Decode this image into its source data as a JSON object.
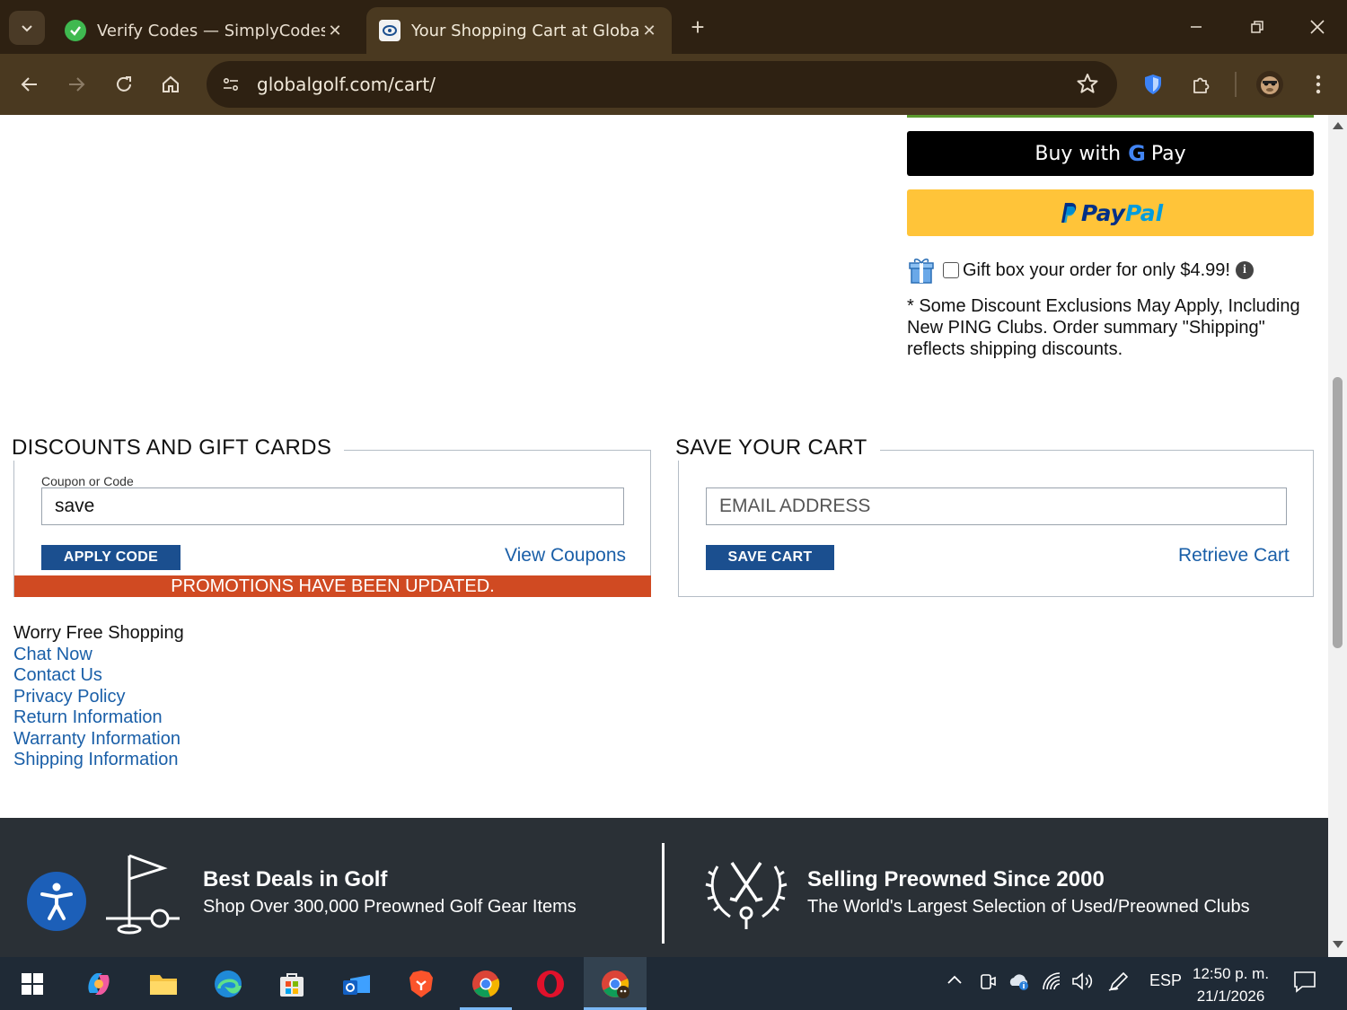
{
  "browser": {
    "tabs": [
      {
        "title": "Verify Codes — SimplyCodes",
        "active": false
      },
      {
        "title": "Your Shopping Cart at GlobalGolf",
        "active": true
      }
    ],
    "url": "globalgolf.com/cart/"
  },
  "checkout": {
    "gpay_prefix": "Buy with",
    "gpay_g": "G",
    "gpay_suffix": "Pay",
    "paypal_part1": "Pay",
    "paypal_part2": "Pal",
    "giftbox_text": "Gift box your order for only $4.99!",
    "giftbox_checked": false,
    "exclusions_text": "* Some Discount Exclusions May Apply, Including New PING Clubs. Order summary \"Shipping\" reflects shipping discounts."
  },
  "discounts": {
    "legend": "DISCOUNTS AND GIFT CARDS",
    "coupon_label": "Coupon or Code",
    "coupon_value": "save",
    "apply_label": "APPLY CODE",
    "view_coupons": "View Coupons",
    "promo_message": "PROMOTIONS HAVE BEEN UPDATED."
  },
  "save_cart": {
    "legend": "SAVE YOUR CART",
    "email_placeholder": "EMAIL ADDRESS",
    "save_label": "SAVE CART",
    "retrieve_label": "Retrieve Cart"
  },
  "footer_links": {
    "heading": "Worry Free Shopping",
    "items": [
      "Chat Now",
      "Contact Us",
      "Privacy Policy",
      "Return Information",
      "Warranty Information",
      "Shipping Information"
    ]
  },
  "promo_band": {
    "left_title": "Best Deals in Golf",
    "left_sub": "Shop Over 300,000 Preowned Golf Gear Items",
    "right_title": "Selling Preowned Since 2000",
    "right_sub": "The World's Largest Selection of Used/Preowned Clubs"
  },
  "taskbar": {
    "language": "ESP",
    "time": "12:50 p. m.",
    "date": "21/1/2026"
  },
  "colors": {
    "promo_banner": "#d04a22",
    "button_blue": "#1b4f8f",
    "link_blue": "#1a5fa8",
    "paypal_yellow": "#ffc439",
    "footer_band": "#2a3036"
  }
}
